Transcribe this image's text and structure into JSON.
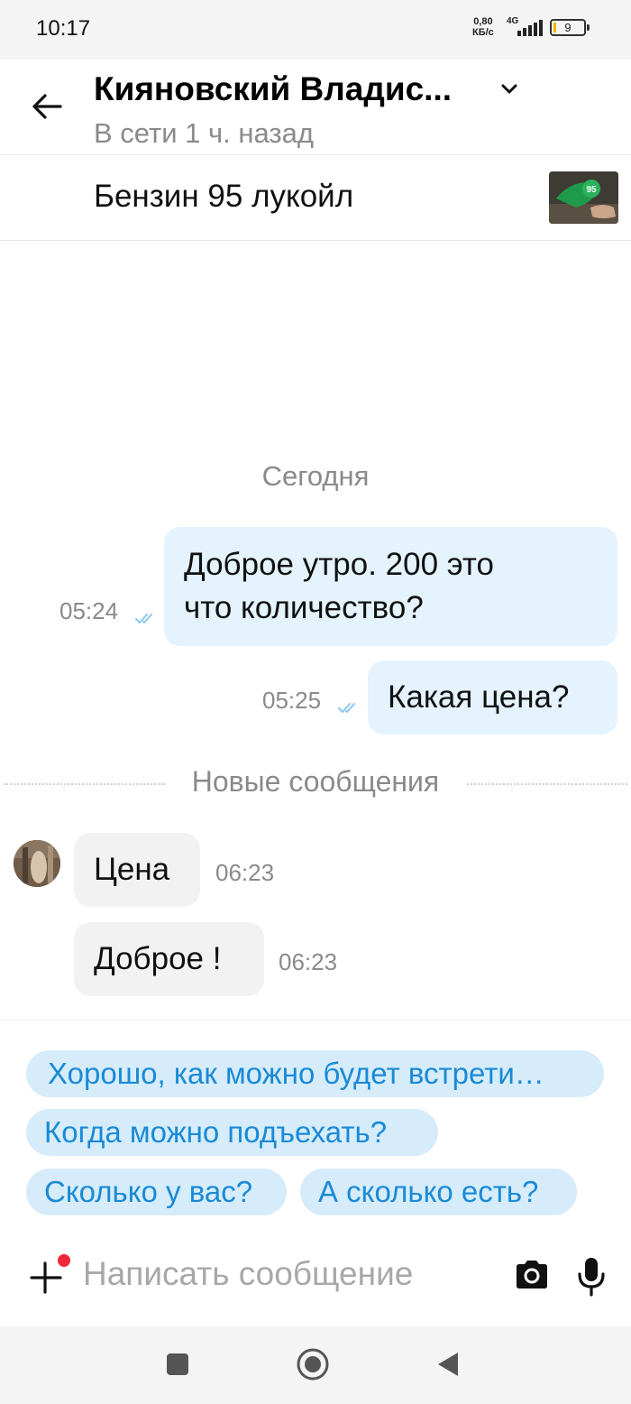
{
  "status_bar": {
    "time": "10:17",
    "net_speed_value": "0,80",
    "net_speed_unit": "КБ/с",
    "network_type": "4G",
    "battery_level": "9"
  },
  "header": {
    "contact_name": "Кияновский Владис...",
    "contact_status": "В сети 1 ч. назад"
  },
  "ad": {
    "title": "Бензин 95 лукойл",
    "thumbnail_badge": "95"
  },
  "chat": {
    "date_separator": "Сегодня",
    "new_messages_label": "Новые сообщения",
    "messages": [
      {
        "direction": "out",
        "text_line1": "Доброе утро. 200 это",
        "text_line2": "что количество?",
        "time": "05:24",
        "read": true
      },
      {
        "direction": "out",
        "text": "Какая цена?",
        "time": "05:25",
        "read": true
      },
      {
        "direction": "in",
        "text": "Цена",
        "time": "06:23"
      },
      {
        "direction": "in",
        "text": "Доброе !",
        "time": "06:23"
      }
    ]
  },
  "quick_replies": [
    "Хорошо, как можно будет встрети…",
    "Когда можно подъехать?",
    "Сколько у вас?",
    "А сколько есть?"
  ],
  "composer": {
    "placeholder": "Написать сообщение",
    "value": ""
  },
  "colors": {
    "outgoing_bubble": "#e4f3fd",
    "incoming_bubble": "#f2f2f2",
    "chip_bg": "#d6ecfb",
    "chip_text": "#1a8ad6",
    "read_ticks": "#8cc7ee",
    "notification_dot": "#f0283c"
  },
  "icons": {
    "back": "arrow-left-icon",
    "name_dropdown": "chevron-down-icon",
    "attach": "plus-icon",
    "camera": "camera-icon",
    "microphone": "microphone-icon",
    "nav_recents": "square-icon",
    "nav_home": "circle-icon",
    "nav_back": "triangle-back-icon"
  }
}
